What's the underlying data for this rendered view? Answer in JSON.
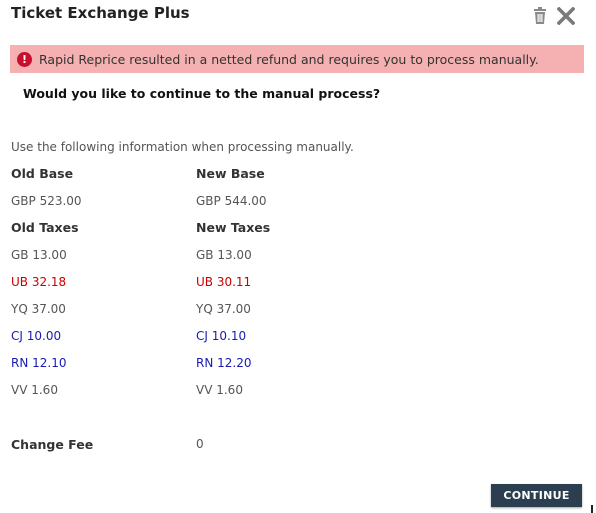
{
  "dialog": {
    "title": "Ticket Exchange Plus"
  },
  "alert": {
    "message": "Rapid Reprice resulted in a netted refund and requires you to process manually.",
    "icon": "exclamation-icon",
    "color": "#f5b0b1"
  },
  "question": "Would you like to continue to the manual process?",
  "instructions": "Use the following information when processing manually.",
  "headers": {
    "old_base": "Old Base",
    "new_base": "New Base",
    "old_taxes": "Old Taxes",
    "new_taxes": "New Taxes",
    "change_fee": "Change Fee"
  },
  "base": {
    "old": "GBP 523.00",
    "new": "GBP 544.00"
  },
  "taxes": [
    {
      "old": "GB 13.00",
      "new": "GB 13.00",
      "status": "unchanged"
    },
    {
      "old": "UB 32.18",
      "new": "UB 30.11",
      "status": "changed"
    },
    {
      "old": "YQ 37.00",
      "new": "YQ 37.00",
      "status": "unchanged"
    },
    {
      "old": "CJ 10.00",
      "new": "CJ 10.10",
      "status": "added"
    },
    {
      "old": "RN 12.10",
      "new": "RN 12.20",
      "status": "added"
    },
    {
      "old": "VV 1.60",
      "new": "VV 1.60",
      "status": "unchanged"
    }
  ],
  "change_fee": "0",
  "buttons": {
    "continue": "CONTINUE"
  },
  "colors": {
    "changed": "#cc0000",
    "added": "#1a1ab8",
    "button": "#2b3f50"
  }
}
